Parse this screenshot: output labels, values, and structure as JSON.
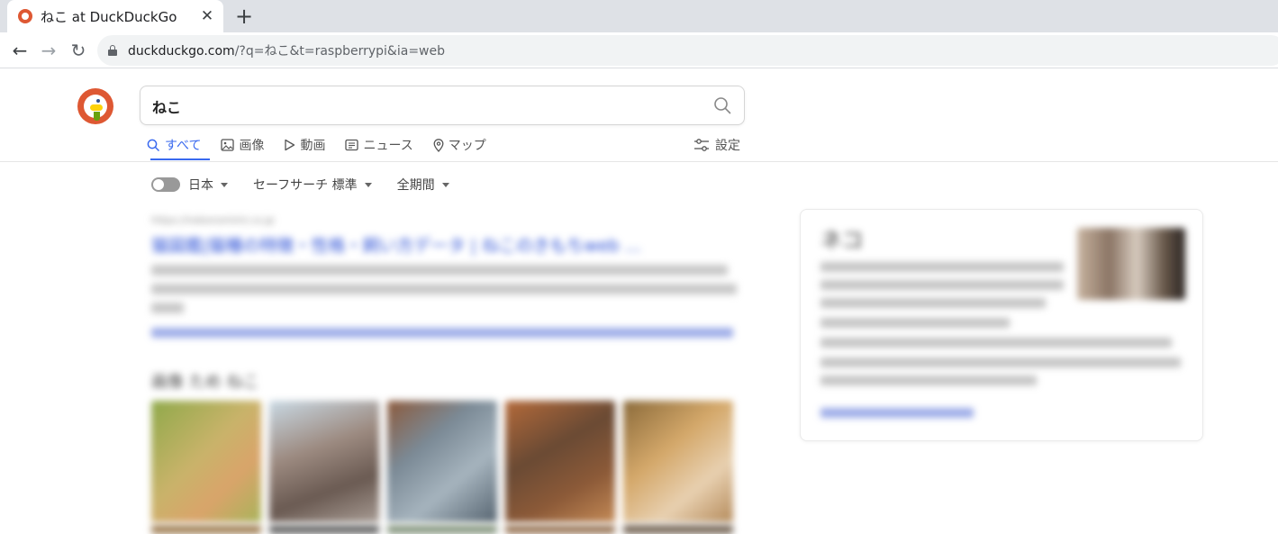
{
  "browser": {
    "tab_title": "ねこ at DuckDuckGo",
    "tab_close": "✕",
    "new_tab": "+",
    "back": "←",
    "forward": "→",
    "reload": "↻",
    "url_host": "duckduckgo.com",
    "url_rest": "/?q=ねこ&t=raspberrypi&ia=web"
  },
  "search": {
    "query": "ねこ"
  },
  "tabs": [
    {
      "label": "すべて",
      "icon": "search-icon",
      "active": true
    },
    {
      "label": "画像",
      "icon": "image-icon"
    },
    {
      "label": "動画",
      "icon": "play-icon"
    },
    {
      "label": "ニュース",
      "icon": "news-icon"
    },
    {
      "label": "マップ",
      "icon": "map-pin-icon"
    }
  ],
  "settings_label": "設定",
  "filters": {
    "region": "日本",
    "safesearch": "セーフサーチ 標準",
    "time": "全期間"
  },
  "result": {
    "source": "https://nekonomimi.co.jp",
    "title": "猫図鑑|猫種の特徴・性格・飼い方データ | ねこのきもちweb ..."
  },
  "images_heading": "画像 ため ねこ",
  "knowledge_panel": {
    "title": "ネコ"
  },
  "colors": {
    "accent": "#3969ef",
    "ddg_orange": "#de5833"
  }
}
